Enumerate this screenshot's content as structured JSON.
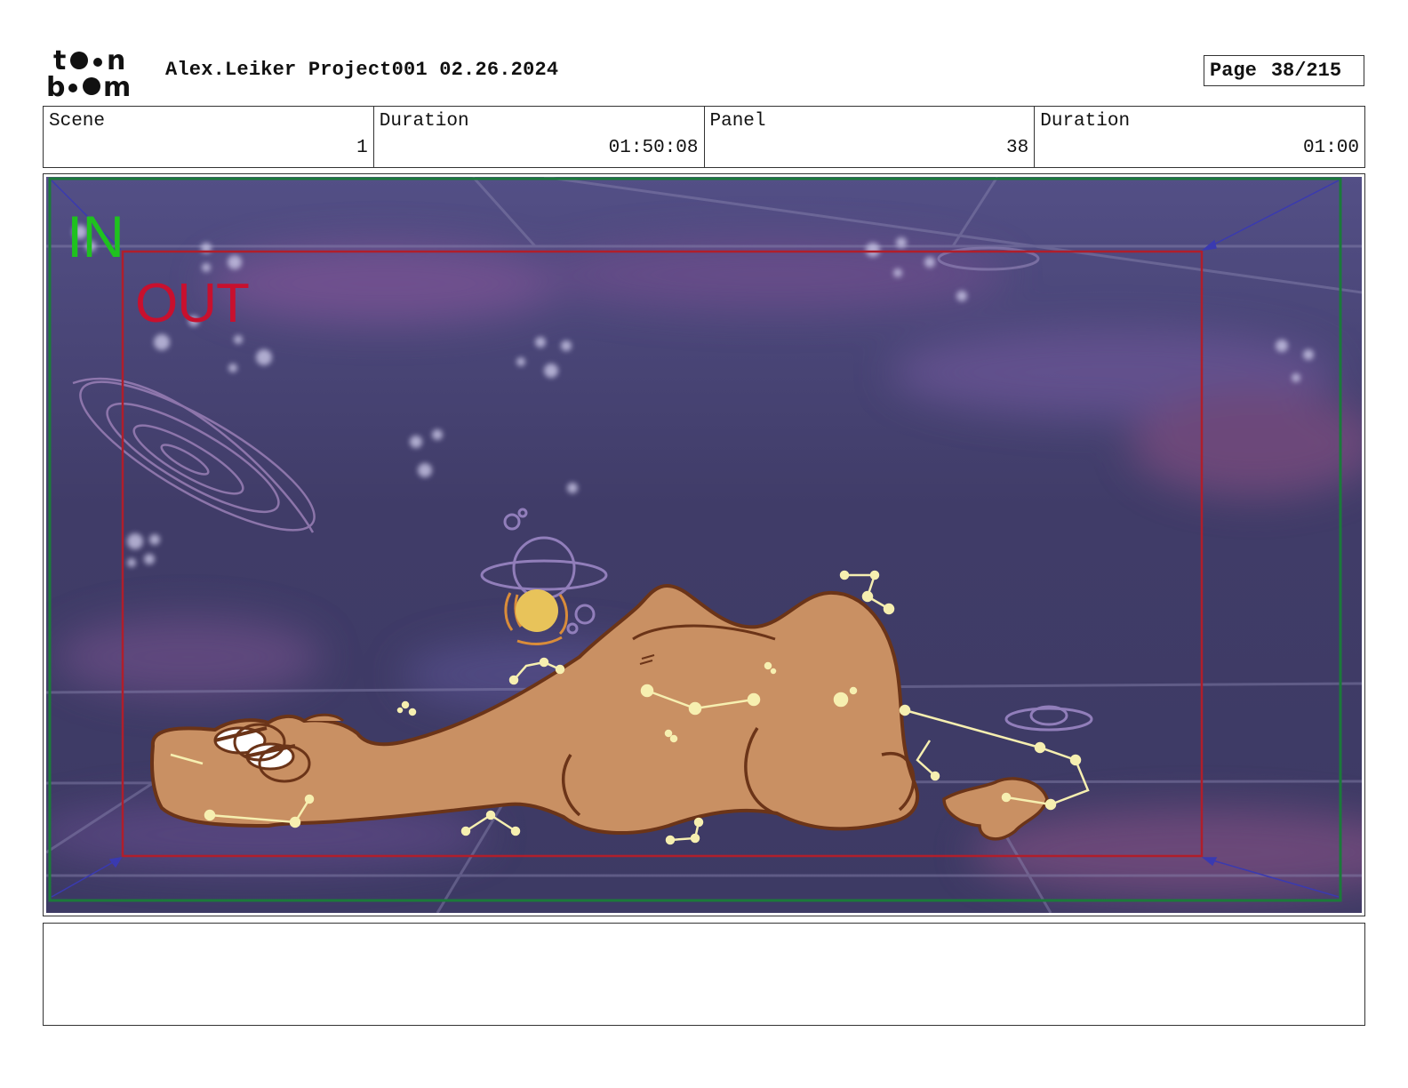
{
  "header": {
    "logo_alt": "toon boom",
    "title": "Alex.Leiker Project001 02.26.2024",
    "page_label": "Page",
    "page_number": "38/215"
  },
  "info": [
    {
      "label": "Scene",
      "value": "1"
    },
    {
      "label": "Duration",
      "value": "01:50:08"
    },
    {
      "label": "Panel",
      "value": "38"
    },
    {
      "label": "Duration",
      "value": "01:00"
    }
  ],
  "panel": {
    "in_label": "IN",
    "out_label": "OUT",
    "colors": {
      "sky": "#433f6e",
      "nebula": "#7a4f8a",
      "camel": "#c99063",
      "outline": "#6b3418",
      "constellation": "#f6efb0",
      "sun": "#e8c35a",
      "in_frame": "#1b7a3a",
      "out_frame": "#b01e2b"
    }
  },
  "notes": {
    "text": ""
  }
}
